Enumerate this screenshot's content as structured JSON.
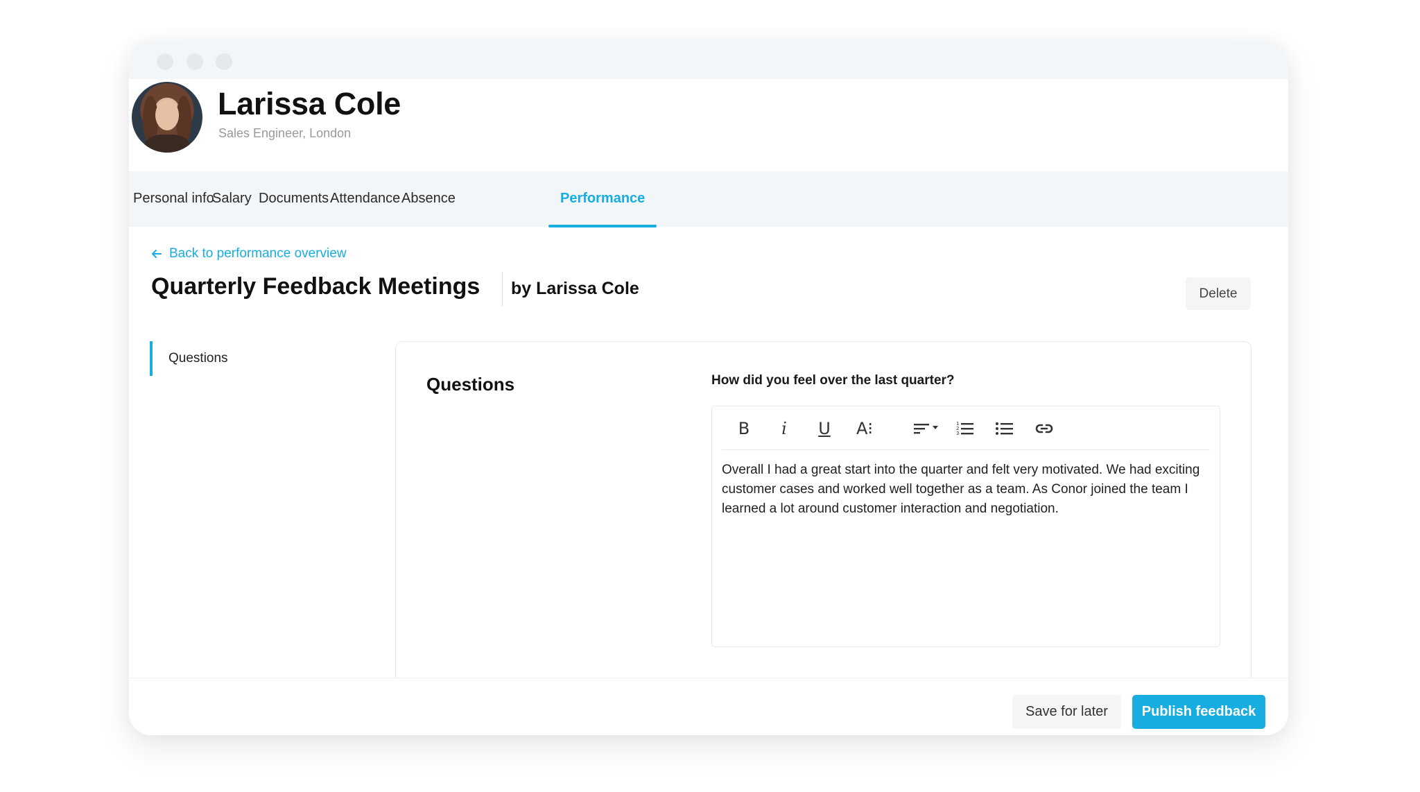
{
  "window": {
    "controls": [
      "close",
      "minimize",
      "maximize"
    ]
  },
  "profile": {
    "name": "Larissa Cole",
    "role": "Sales Engineer, London",
    "avatar": "profile-photo"
  },
  "tabs": [
    {
      "label": "Personal info",
      "active": false
    },
    {
      "label": "Salary",
      "active": false
    },
    {
      "label": "Documents",
      "active": false
    },
    {
      "label": "Attendance",
      "active": false
    },
    {
      "label": "Absence",
      "active": false
    },
    {
      "label": "Performance",
      "active": true
    }
  ],
  "page": {
    "back_link": "Back to performance overview",
    "title": "Quarterly Feedback Meetings",
    "author": "by Larissa Cole",
    "delete_label": "Delete"
  },
  "sidebar": {
    "items": [
      {
        "label": "Questions",
        "active": true
      }
    ]
  },
  "card": {
    "heading": "Questions",
    "question": "How did you feel over the last quarter?",
    "toolbar": {
      "bold": "B",
      "italic": "i",
      "underline": "U",
      "font_size": "A⁝",
      "icons": [
        "bold-icon",
        "italic-icon",
        "underline-icon",
        "font-size-icon",
        "align-icon",
        "ordered-list-icon",
        "bullet-list-icon",
        "link-icon"
      ]
    },
    "answer": "Overall I had a great start into the quarter and felt very motivated. We had exciting customer cases and worked well together as a team. As Conor joined the team I learned a lot around customer interaction and negotiation."
  },
  "footer": {
    "save_label": "Save for later",
    "publish_label": "Publish feedback"
  },
  "colors": {
    "accent": "#17ade0",
    "chrome": "#f3f6f8"
  }
}
